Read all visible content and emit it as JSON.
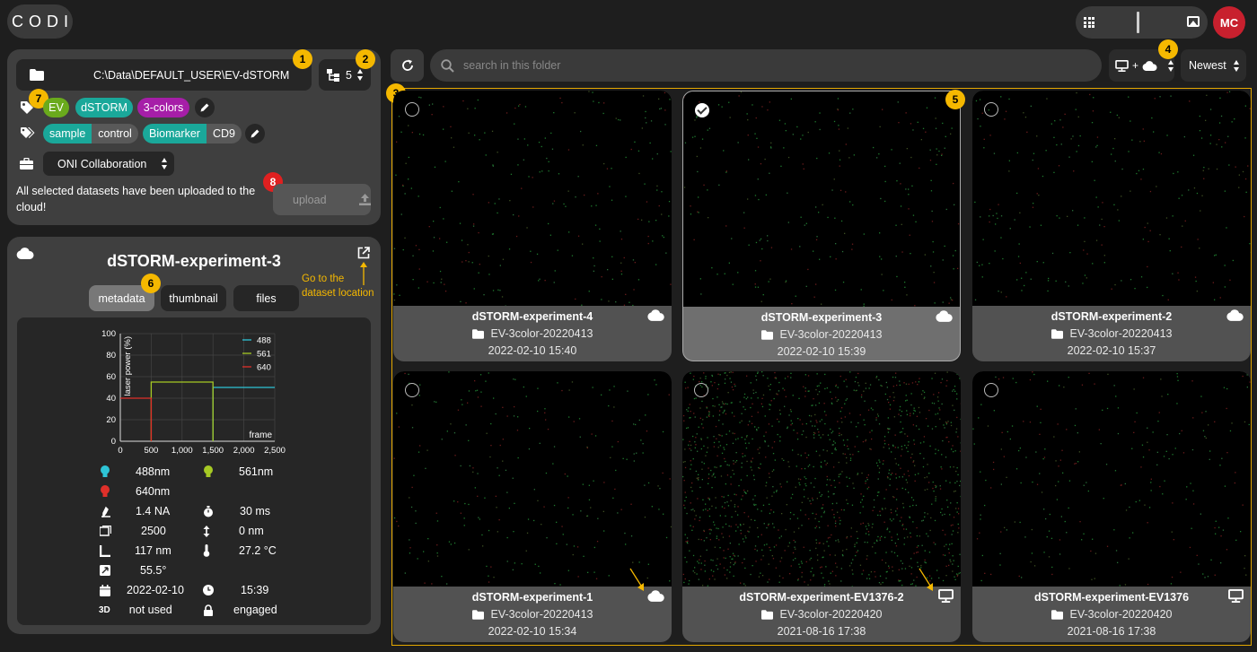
{
  "app": {
    "logo_text": "CODI"
  },
  "header": {
    "avatar_initials": "MC"
  },
  "project": {
    "path": "C:\\Data\\DEFAULT_USER\\EV-dSTORM",
    "count": "5",
    "tags": [
      "EV",
      "dSTORM",
      "3-colors"
    ],
    "pairs": [
      {
        "key": "sample",
        "value": "control"
      },
      {
        "key": "Biomarker",
        "value": "CD9"
      }
    ],
    "collaboration": "ONI Collaboration",
    "status_message": "All selected datasets have been uploaded to the cloud!",
    "upload_label": "upload"
  },
  "annotations": {
    "b1": "1",
    "b2": "2",
    "b3": "3",
    "b4": "4",
    "b5": "5",
    "b6": "6",
    "b7": "7",
    "b8": "8",
    "goto_line1": "Go to the",
    "goto_line2": "dataset location"
  },
  "dataset": {
    "title": "dSTORM-experiment-3",
    "tabs": [
      "metadata",
      "thumbnail",
      "files"
    ],
    "active_tab": "metadata",
    "props": {
      "laser1": "488nm",
      "laser2": "561nm",
      "laser3": "640nm",
      "na": "1.4 NA",
      "exposure": "30 ms",
      "frames": "2500",
      "z": "0 nm",
      "pixel": "117 nm",
      "temp": "27.2 °C",
      "angle": "55.5°",
      "date": "2022-02-10",
      "time": "15:39",
      "mode3d": "not used",
      "lock": "engaged"
    }
  },
  "chart_data": {
    "type": "line",
    "title": "",
    "xlabel": "frame",
    "ylabel": "laser power (%)",
    "xlim": [
      0,
      2500
    ],
    "ylim": [
      0,
      100
    ],
    "xticks": [
      "0",
      "500",
      "1,000",
      "1,500",
      "2,000",
      "2,500"
    ],
    "yticks": [
      "0",
      "20",
      "40",
      "60",
      "80",
      "100"
    ],
    "grid": true,
    "legend_position": "top-right",
    "series": [
      {
        "name": "488",
        "color": "#2ec4d6",
        "x": [
          1500,
          1500,
          2500
        ],
        "y": [
          0,
          50,
          50
        ]
      },
      {
        "name": "561",
        "color": "#a6c924",
        "x": [
          500,
          500,
          1500,
          1500
        ],
        "y": [
          0,
          55,
          55,
          0
        ]
      },
      {
        "name": "640",
        "color": "#e0302a",
        "x": [
          0,
          500,
          500
        ],
        "y": [
          40,
          40,
          0
        ]
      }
    ]
  },
  "toolbar": {
    "search_placeholder": "search in this folder",
    "source_plus": "+",
    "sort_label": "Newest"
  },
  "cards": [
    {
      "name": "dSTORM-experiment-4",
      "folder": "EV-3color-20220413",
      "date": "2022-02-10 15:40",
      "location": "cloud",
      "selected": false
    },
    {
      "name": "dSTORM-experiment-3",
      "folder": "EV-3color-20220413",
      "date": "2022-02-10 15:39",
      "location": "cloud",
      "selected": true
    },
    {
      "name": "dSTORM-experiment-2",
      "folder": "EV-3color-20220413",
      "date": "2022-02-10 15:37",
      "location": "cloud",
      "selected": false
    },
    {
      "name": "dSTORM-experiment-1",
      "folder": "EV-3color-20220413",
      "date": "2022-02-10 15:34",
      "location": "cloud",
      "selected": false
    },
    {
      "name": "dSTORM-experiment-EV1376-2",
      "folder": "EV-3color-20220420",
      "date": "2021-08-16 17:38",
      "location": "local",
      "selected": false
    },
    {
      "name": "dSTORM-experiment-EV1376",
      "folder": "EV-3color-20220420",
      "date": "2021-08-16 17:38",
      "location": "local",
      "selected": false
    }
  ],
  "colors": {
    "accent": "#f5b800",
    "tag_ev": "#6aaa1c",
    "tag_teal": "#1aa89a",
    "tag_purple": "#a61ea8",
    "avatar": "#c8202e"
  }
}
